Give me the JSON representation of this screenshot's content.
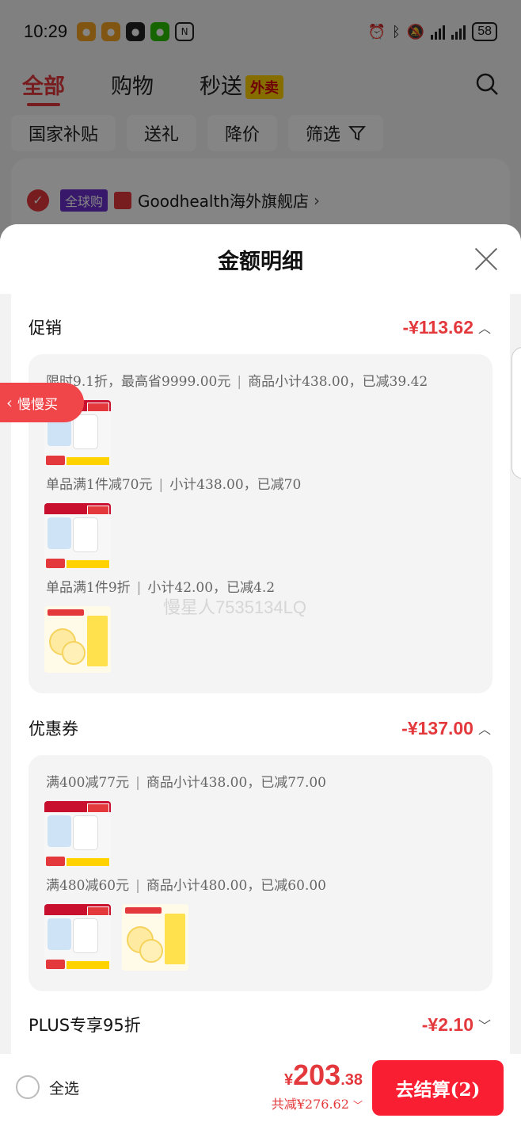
{
  "status_bar": {
    "time": "10:29",
    "battery": "58"
  },
  "top_tabs": [
    {
      "label": "全部"
    },
    {
      "label": "购物"
    },
    {
      "label": "秒送"
    }
  ],
  "waimai_badge": "外卖",
  "filters": [
    "国家补贴",
    "送礼",
    "降价",
    "筛选"
  ],
  "store": {
    "tag": "全球购",
    "name": "Goodhealth海外旗舰店",
    "arrow": "›"
  },
  "sheet": {
    "title": "金额明细",
    "promo": {
      "title": "促销",
      "amount": "-¥113.62",
      "rules": [
        {
          "text": "限时9.1折，最高省9999.00元",
          "detail": "商品小计438.00，已减39.42"
        },
        {
          "text": "单品满1件减70元",
          "detail": "小计438.00，已减70"
        },
        {
          "text": "单品满1件9折",
          "detail": "小计42.00，已减4.2"
        }
      ]
    },
    "coupon": {
      "title": "优惠券",
      "amount": "-¥137.00",
      "rules": [
        {
          "text": "满400减77元",
          "detail": "商品小计438.00，已减77.00"
        },
        {
          "text": "满480减60元",
          "detail": "商品小计480.00，已减60.00"
        }
      ]
    },
    "plus": {
      "title": "PLUS专享95折",
      "amount": "-¥2.10"
    },
    "separator": "|"
  },
  "watermark": "慢星人7535134LQ",
  "side_pill": {
    "label": "慢慢买",
    "arrow": "‹"
  },
  "bottom": {
    "select_all": "全选",
    "total_yen": "¥",
    "total_int": "203",
    "total_dec": ".38",
    "saved": "共减¥276.62",
    "checkout": "去结算(2)"
  },
  "colors": {
    "accent": "#e4393c",
    "button": "#fa1e32"
  },
  "icons": [
    "search-icon",
    "close-icon",
    "chevron-up-icon",
    "chevron-down-icon",
    "filter-icon",
    "check-icon"
  ]
}
